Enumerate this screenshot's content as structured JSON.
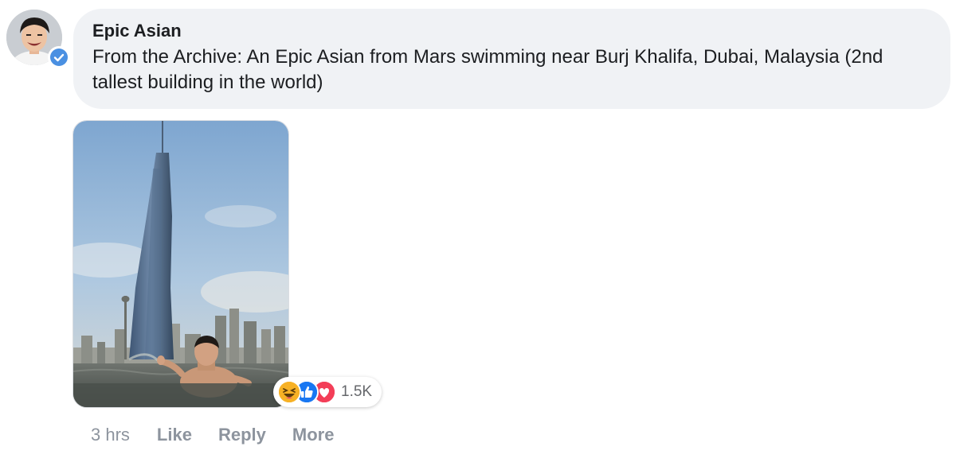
{
  "comment": {
    "author": "Epic Asian",
    "text": "From the Archive: An Epic Asian from Mars swimming near Burj Khalifa, Dubai, Malaysia (2nd tallest building in the world)",
    "avatar_icon": "profile-photo",
    "verified_icon": "verified-badge-icon",
    "photo": "skyscraper-and-swimmer-photo"
  },
  "reactions": {
    "icons": [
      "haha-reaction-icon",
      "like-reaction-icon",
      "love-reaction-icon"
    ],
    "count": "1.5K"
  },
  "actions": {
    "time": "3 hrs",
    "like": "Like",
    "reply": "Reply",
    "more": "More"
  },
  "colors": {
    "bubble": "#f0f2f5",
    "text": "#1c1e21",
    "muted": "#8d949e",
    "verified": "#4a90e2",
    "like": "#1877f2",
    "love": "#f33e58",
    "haha": "#f7b125"
  }
}
